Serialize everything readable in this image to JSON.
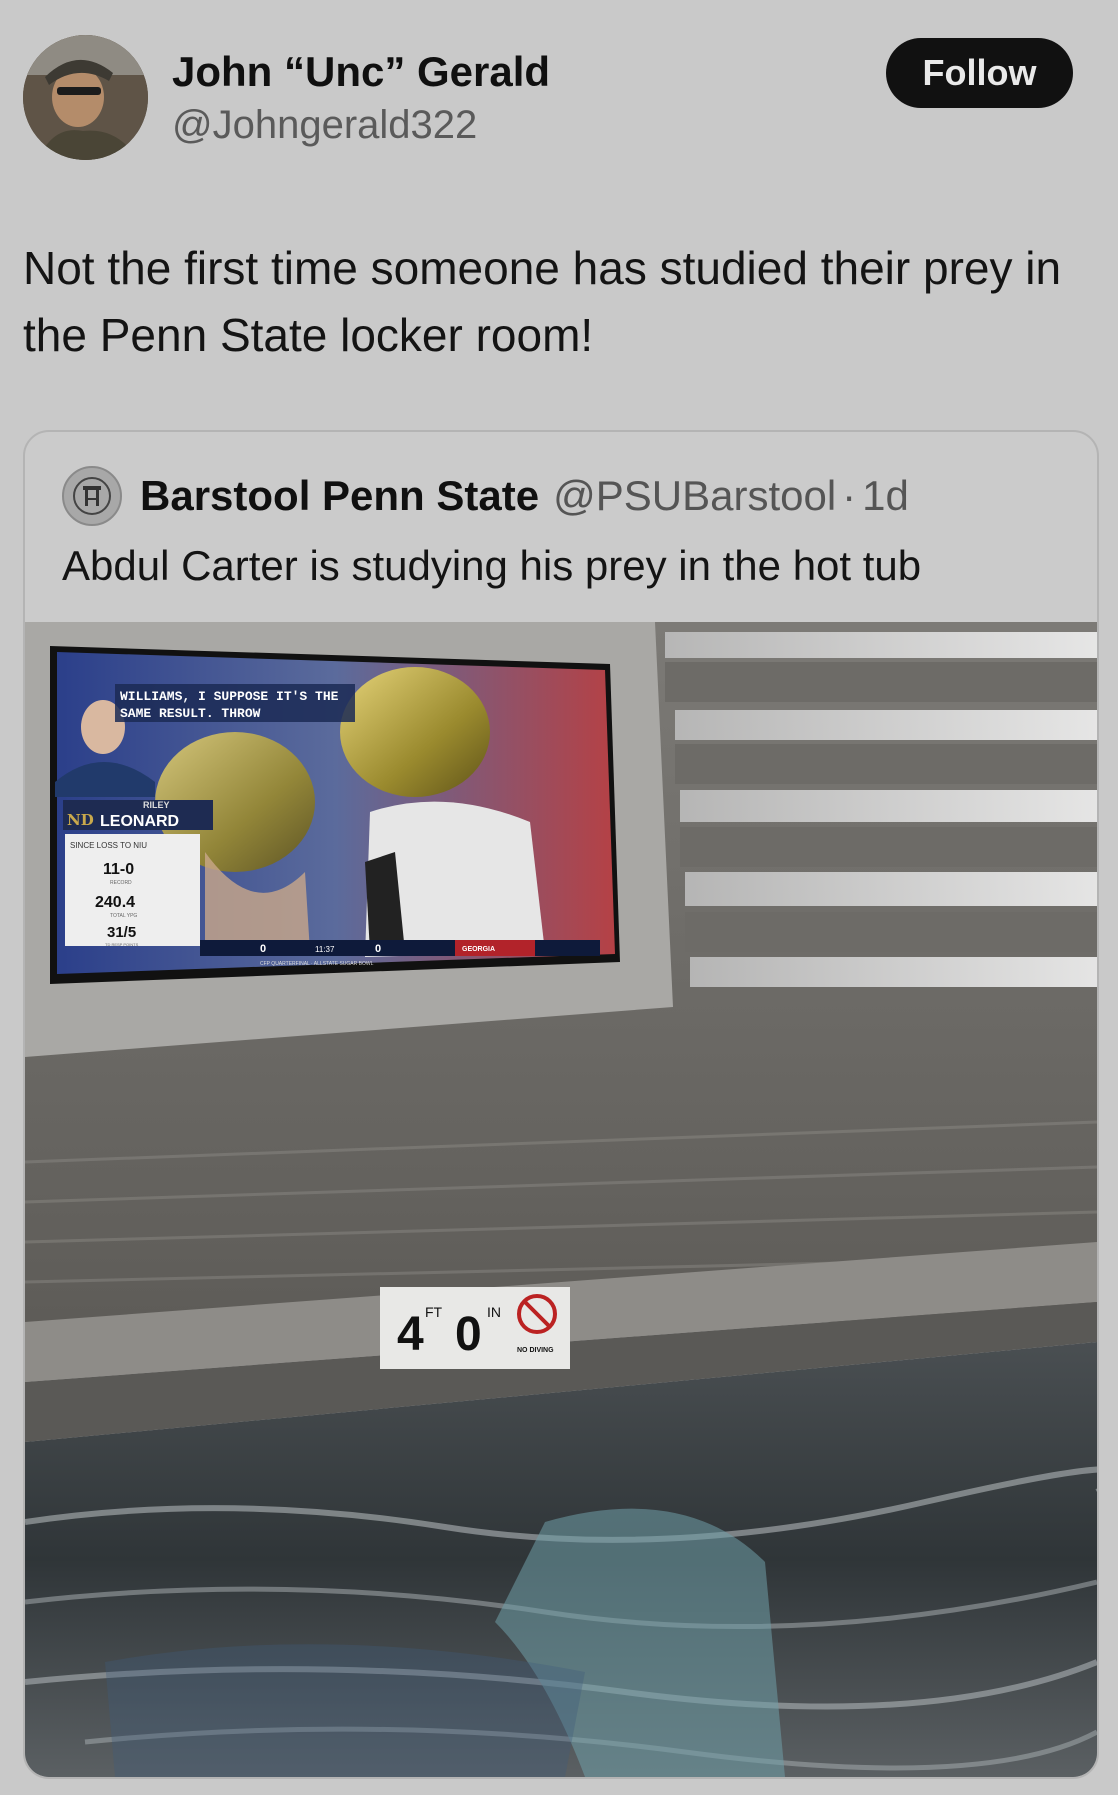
{
  "author": {
    "name": "John “Unc” Gerald",
    "handle": "@Johngerald322",
    "follow_label": "Follow"
  },
  "tweet": {
    "text": "Not the first time someone has studied their prey in the Penn State locker room!"
  },
  "quoted": {
    "name": "Barstool Penn State",
    "handle": "@PSUBarstool",
    "separator": "·",
    "time": "1d",
    "text": "Abdul Carter is studying his prey in the hot tub"
  },
  "photo": {
    "tv_caption_line1": "WILLIAMS, I SUPPOSE IT'S THE",
    "tv_caption_line2": "SAME RESULT. THROW",
    "player_first": "RILEY",
    "player_last": "LEONARD",
    "stat_header": "SINCE LOSS TO NIU",
    "stat_1_value": "11-0",
    "stat_1_label": "RECORD",
    "stat_2_value": "240.4",
    "stat_2_label": "TOTAL YPG",
    "stat_3_value": "31/5",
    "stat_3_label": "TD RESP POINTS",
    "score_clock": "11:37",
    "score_home": "0",
    "score_away": "0",
    "score_team": "GEORGIA",
    "bowl_name": "CFP QUARTERFINAL · ALLSTATE SUGAR BOWL",
    "depth_feet": "4",
    "depth_ft_label": "FT",
    "depth_inches": "0",
    "depth_in_label": "IN",
    "no_diving": "NO DIVING"
  },
  "colors": {
    "background": "#c9c9c9",
    "follow_bg": "#111111",
    "follow_text": "#e9e9e9",
    "handle": "#5a5a5a"
  }
}
